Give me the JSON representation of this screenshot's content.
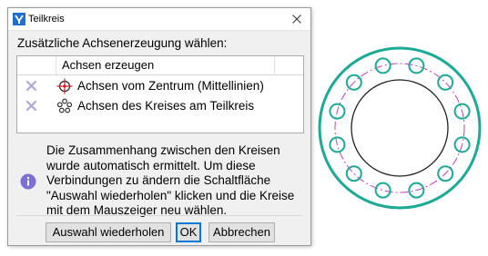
{
  "window": {
    "title": "Teilkreis",
    "close_glyph": "✕"
  },
  "heading": "Zusätzliche Achsenerzeugung wählen:",
  "list": {
    "column_header": "Achsen erzeugen",
    "items": [
      {
        "label": "Achsen vom Zentrum (Mittellinien)",
        "state_icon": "x-mark-icon",
        "icon": "center-crosshair-icon"
      },
      {
        "label": "Achsen des Kreises am Teilkreis",
        "state_icon": "x-mark-icon",
        "icon": "circle-pattern-icon"
      }
    ]
  },
  "message": "Die Zusammenhang zwischen den Kreisen wurde automatisch ermittelt. Um diese Verbindungen zu ändern die Schaltfläche \"Auswahl wiederholen\" klicken und die Kreise mit dem Mauszeiger neu wählen.",
  "buttons": {
    "reselect": "Auswahl wiederholen",
    "ok": "OK",
    "cancel": "Abbrechen"
  },
  "drawing": {
    "hole_count": 12,
    "colors": {
      "outline": "#1aaa95",
      "pitch_circle": "#c040c0",
      "inner": "#222222",
      "hole": "#1aaa95"
    }
  },
  "colors": {
    "accent": "#0078d7",
    "info": "#7b6fd6",
    "x_mark": "#a8a8dc",
    "crosshair": "#d42020"
  }
}
